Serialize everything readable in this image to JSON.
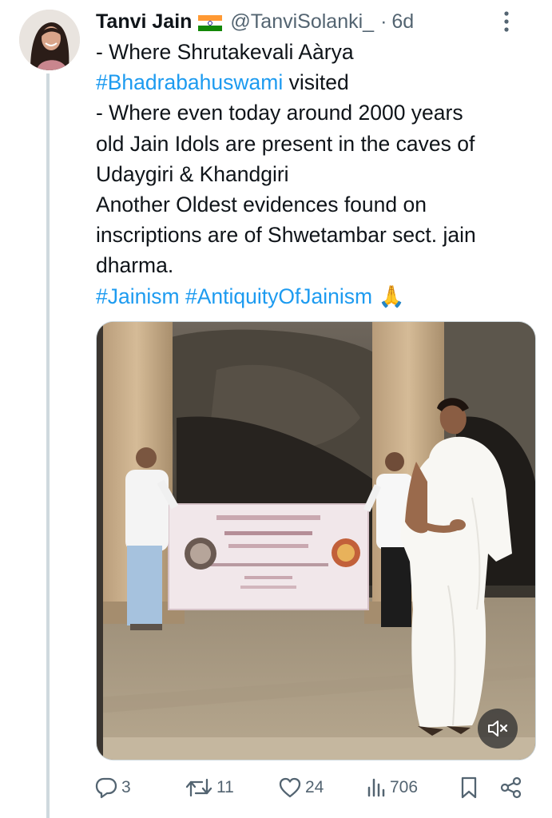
{
  "tweet": {
    "author_name": "Tanvi Jain",
    "flag_icon": "india-flag-icon",
    "handle": "@TanviSolanki_",
    "separator": "·",
    "time": "6d",
    "text_lines": [
      "- Where Shrutakevali Aàrya",
      "#Bhadrabahuswami",
      " visited",
      "-  Where even today around 2000 years",
      "old Jain Idols are present in the caves of",
      "Udaygiri & Khandgiri",
      "Another Oldest evidences found on",
      "inscriptions are of Shwetambar sect. jain",
      "dharma.",
      "#Jainism",
      "#AntiquityOfJainism",
      "🙏"
    ],
    "hashtag_color": "#1d9bf0"
  },
  "media": {
    "type": "video",
    "mute_icon": "speaker-muted-icon"
  },
  "actions": {
    "replies": "3",
    "retweets": "11",
    "likes": "24",
    "views": "706"
  }
}
